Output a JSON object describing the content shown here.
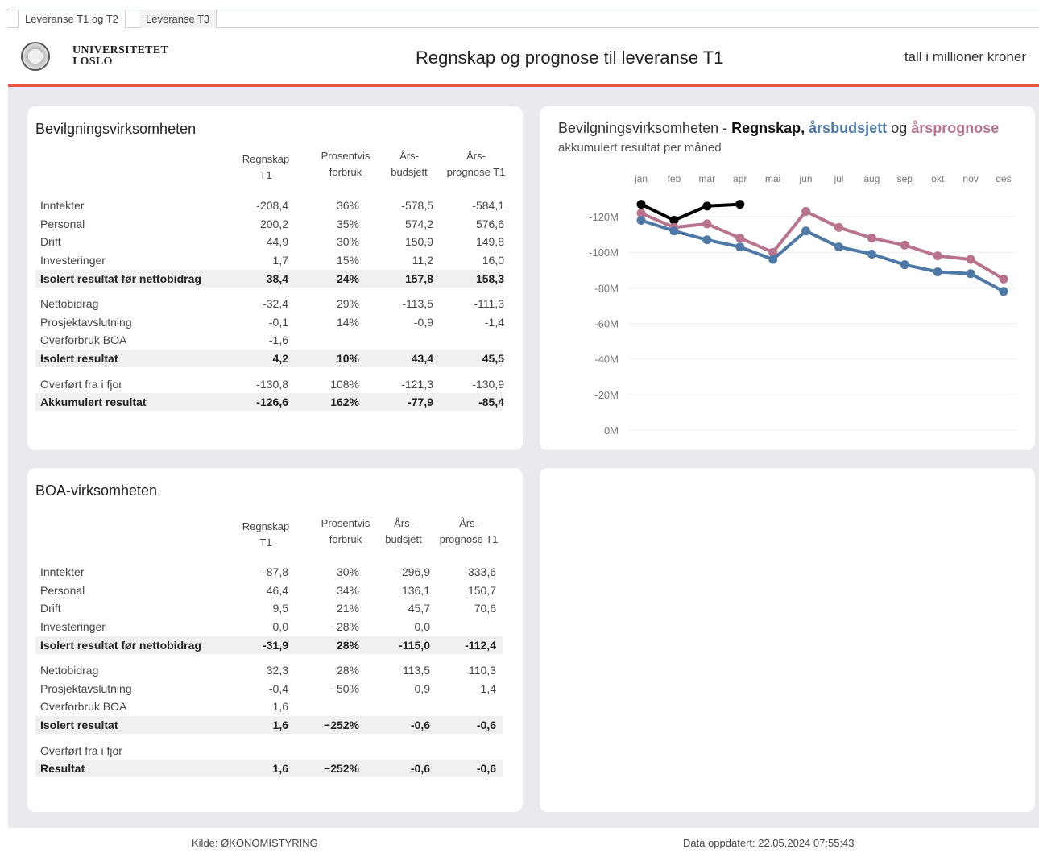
{
  "tabs": [
    {
      "label": "Leveranse T1 og T2",
      "active": true
    },
    {
      "label": "Leveranse T3",
      "active": false
    }
  ],
  "header": {
    "logo_line1": "UNIVERSITETET",
    "logo_line2": "I OSLO",
    "title": "Regnskap og prognose til leveranse T1",
    "unit": "tall i millioner kroner"
  },
  "bevilgning": {
    "title": "Bevilgningsvirksomheten",
    "columns": [
      [
        "Regnskap",
        "T1"
      ],
      [
        "Prosentvis",
        "forbruk"
      ],
      [
        "Års-",
        "budsjett"
      ],
      [
        "Års-",
        "prognose T1"
      ]
    ],
    "rows": [
      {
        "label": "Inntekter",
        "v": [
          "-208,4",
          "36%",
          "-578,5",
          "-584,1"
        ],
        "bold": false
      },
      {
        "label": "Personal",
        "v": [
          "200,2",
          "35%",
          "574,2",
          "576,6"
        ],
        "bold": false
      },
      {
        "label": "Drift",
        "v": [
          "44,9",
          "30%",
          "150,9",
          "149,8"
        ],
        "bold": false
      },
      {
        "label": "Investeringer",
        "v": [
          "1,7",
          "15%",
          "11,2",
          "16,0"
        ],
        "bold": false
      },
      {
        "label": "Isolert resultat før nettobidrag",
        "v": [
          "38,4",
          "24%",
          "157,8",
          "158,3"
        ],
        "bold": true
      },
      {
        "label": "Nettobidrag",
        "v": [
          "-32,4",
          "29%",
          "-113,5",
          "-111,3"
        ],
        "bold": false
      },
      {
        "label": "Prosjektavslutning",
        "v": [
          "-0,1",
          "14%",
          "-0,9",
          "-1,4"
        ],
        "bold": false
      },
      {
        "label": "Overforbruk BOA",
        "v": [
          "-1,6",
          "",
          "",
          ""
        ],
        "bold": false
      },
      {
        "label": "Isolert resultat",
        "v": [
          "4,2",
          "10%",
          "43,4",
          "45,5"
        ],
        "bold": true
      },
      {
        "label": "Overført fra i fjor",
        "v": [
          "-130,8",
          "108%",
          "-121,3",
          "-130,9"
        ],
        "bold": false
      },
      {
        "label": "Akkumulert resultat",
        "v": [
          "-126,6",
          "162%",
          "-77,9",
          "-85,4"
        ],
        "bold": true
      }
    ]
  },
  "boa": {
    "title": "BOA-virksomheten",
    "columns": [
      [
        "Regnskap",
        "T1"
      ],
      [
        "Prosentvis",
        "forbruk"
      ],
      [
        "Års-",
        "budsjett"
      ],
      [
        "Års-",
        "prognose T1"
      ]
    ],
    "rows": [
      {
        "label": "Inntekter",
        "v": [
          "-87,8",
          "30%",
          "-296,9",
          "-333,6"
        ],
        "bold": false
      },
      {
        "label": "Personal",
        "v": [
          "46,4",
          "34%",
          "136,1",
          "150,7"
        ],
        "bold": false
      },
      {
        "label": "Drift",
        "v": [
          "9,5",
          "21%",
          "45,7",
          "70,6"
        ],
        "bold": false
      },
      {
        "label": "Investeringer",
        "v": [
          "0,0",
          "−28%",
          "0,0",
          ""
        ],
        "bold": false
      },
      {
        "label": "Isolert resultat før nettobidrag",
        "v": [
          "-31,9",
          "28%",
          "-115,0",
          "-112,4"
        ],
        "bold": true
      },
      {
        "label": "Nettobidrag",
        "v": [
          "32,3",
          "28%",
          "113,5",
          "110,3"
        ],
        "bold": false
      },
      {
        "label": "Prosjektavslutning",
        "v": [
          "-0,4",
          "−50%",
          "0,9",
          "1,4"
        ],
        "bold": false
      },
      {
        "label": "Overforbruk BOA",
        "v": [
          "1,6",
          "",
          "",
          ""
        ],
        "bold": false
      },
      {
        "label": "Isolert resultat",
        "v": [
          "1,6",
          "−252%",
          "-0,6",
          "-0,6"
        ],
        "bold": true
      },
      {
        "label": "Overført fra i fjor",
        "v": [
          "",
          "",
          "",
          ""
        ],
        "bold": false
      },
      {
        "label": "Resultat",
        "v": [
          "1,6",
          "−252%",
          "-0,6",
          "-0,6"
        ],
        "bold": true
      }
    ]
  },
  "chart_title": {
    "prefix": "Bevilgningsvirksomheten - ",
    "part1": "Regnskap,",
    "part2": "årsbudsjett",
    "mid": " og ",
    "part3": "årsprognose",
    "subtitle": "akkumulert resultat per måned"
  },
  "colors": {
    "regnskap": "#000000",
    "budsjett": "#4e79a7",
    "prognose": "#b9738f",
    "accent_line": "#e5534b"
  },
  "chart_data": {
    "type": "line",
    "x": [
      "jan",
      "feb",
      "mar",
      "apr",
      "mai",
      "jun",
      "jul",
      "aug",
      "sep",
      "okt",
      "nov",
      "des"
    ],
    "y_tick_labels": [
      "-120M",
      "-100M",
      "-80M",
      "-60M",
      "-40M",
      "-20M",
      "0M"
    ],
    "y_ticks": [
      -120,
      -100,
      -80,
      -60,
      -40,
      -20,
      0
    ],
    "ylim": [
      -130,
      0
    ],
    "y_inverted": true,
    "x_axis_position": "top",
    "grid": true,
    "series": [
      {
        "key": "regnskap",
        "values": [
          -127,
          -118,
          -126,
          -127,
          null,
          null,
          null,
          null,
          null,
          null,
          null,
          null
        ]
      },
      {
        "key": "prognose",
        "values": [
          -122,
          -114,
          -116,
          -108,
          -100,
          -123,
          -114,
          -108,
          -104,
          -98,
          -96,
          -85
        ]
      },
      {
        "key": "budsjett",
        "values": [
          -118,
          -112,
          -107,
          -103,
          -96,
          -112,
          -103,
          -99,
          -93,
          -89,
          -88,
          -78
        ]
      }
    ]
  },
  "footer": {
    "source": "Kilde: ØKONOMISTYRING",
    "updated": "Data oppdatert:  22.05.2024 07:55:43"
  }
}
